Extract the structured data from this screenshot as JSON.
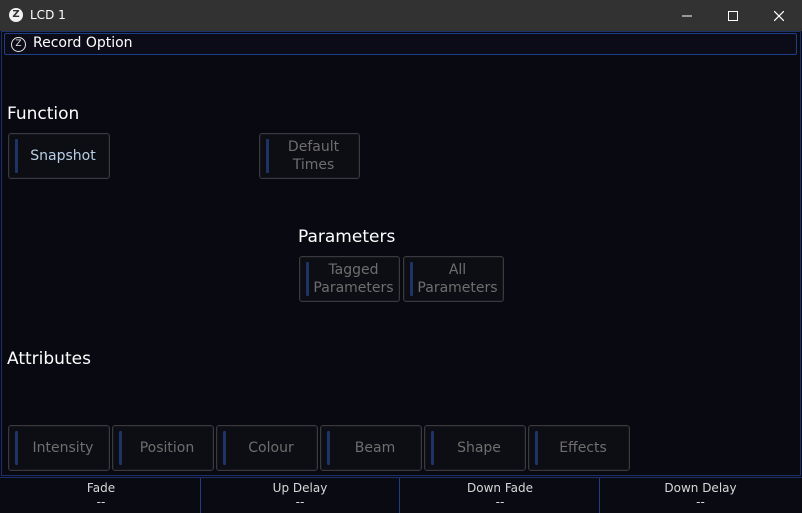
{
  "window": {
    "title": "LCD 1",
    "app_icon": "Z"
  },
  "panel": {
    "title": "Record Option",
    "icon": "Z"
  },
  "function": {
    "label": "Function",
    "snapshot": "Snapshot",
    "default_times": [
      "Default",
      "Times"
    ]
  },
  "parameters": {
    "label": "Parameters",
    "tagged": [
      "Tagged",
      "Parameters"
    ],
    "all": [
      "All",
      "Parameters"
    ]
  },
  "attributes": {
    "label": "Attributes",
    "items": [
      "Intensity",
      "Position",
      "Colour",
      "Beam",
      "Shape",
      "Effects"
    ]
  },
  "footer": [
    {
      "label": "Fade",
      "value": "--"
    },
    {
      "label": "Up Delay",
      "value": "--"
    },
    {
      "label": "Down Fade",
      "value": "--"
    },
    {
      "label": "Down Delay",
      "value": "--"
    }
  ],
  "colors": {
    "accent": "#1d3566",
    "border": "#1e3e88",
    "active_text": "#b8cfe6",
    "disabled_text": "#6e6e6e"
  }
}
